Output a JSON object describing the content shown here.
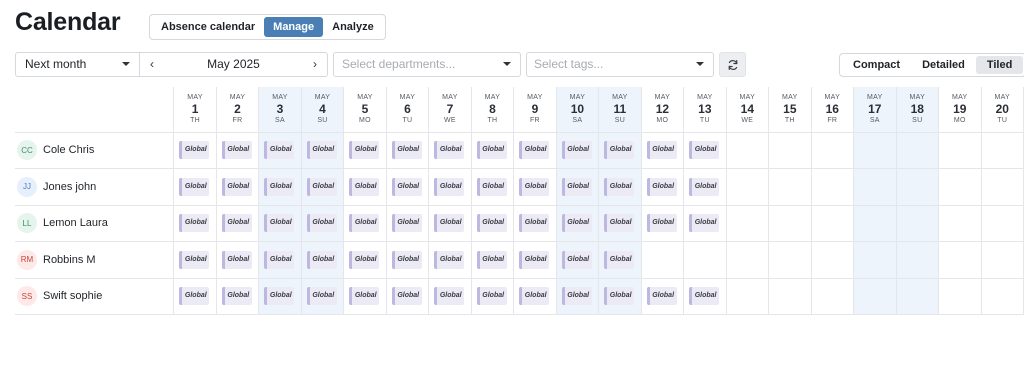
{
  "header": {
    "title": "Calendar"
  },
  "view_tabs": [
    {
      "label": "Absence calendar",
      "active": false
    },
    {
      "label": "Manage",
      "active": true
    },
    {
      "label": "Analyze",
      "active": false
    }
  ],
  "filters": {
    "period": "Next month",
    "month": "May 2025",
    "prev_icon": "chevron-left-icon",
    "next_icon": "chevron-right-icon",
    "departments_placeholder": "Select departments...",
    "tags_placeholder": "Select tags...",
    "refresh_icon": "refresh-icon"
  },
  "density_tabs": [
    {
      "label": "Compact",
      "active": false
    },
    {
      "label": "Detailed",
      "active": false
    },
    {
      "label": "Tiled",
      "active": true
    }
  ],
  "days": [
    {
      "mon": "MAY",
      "num": "1",
      "dow": "TH",
      "weekend": false
    },
    {
      "mon": "MAY",
      "num": "2",
      "dow": "FR",
      "weekend": false
    },
    {
      "mon": "MAY",
      "num": "3",
      "dow": "SA",
      "weekend": true
    },
    {
      "mon": "MAY",
      "num": "4",
      "dow": "SU",
      "weekend": true
    },
    {
      "mon": "MAY",
      "num": "5",
      "dow": "MO",
      "weekend": false
    },
    {
      "mon": "MAY",
      "num": "6",
      "dow": "TU",
      "weekend": false
    },
    {
      "mon": "MAY",
      "num": "7",
      "dow": "WE",
      "weekend": false
    },
    {
      "mon": "MAY",
      "num": "8",
      "dow": "TH",
      "weekend": false
    },
    {
      "mon": "MAY",
      "num": "9",
      "dow": "FR",
      "weekend": false
    },
    {
      "mon": "MAY",
      "num": "10",
      "dow": "SA",
      "weekend": true
    },
    {
      "mon": "MAY",
      "num": "11",
      "dow": "SU",
      "weekend": true
    },
    {
      "mon": "MAY",
      "num": "12",
      "dow": "MO",
      "weekend": false
    },
    {
      "mon": "MAY",
      "num": "13",
      "dow": "TU",
      "weekend": false
    },
    {
      "mon": "MAY",
      "num": "14",
      "dow": "WE",
      "weekend": false
    },
    {
      "mon": "MAY",
      "num": "15",
      "dow": "TH",
      "weekend": false
    },
    {
      "mon": "MAY",
      "num": "16",
      "dow": "FR",
      "weekend": false
    },
    {
      "mon": "MAY",
      "num": "17",
      "dow": "SA",
      "weekend": true
    },
    {
      "mon": "MAY",
      "num": "18",
      "dow": "SU",
      "weekend": true
    },
    {
      "mon": "MAY",
      "num": "19",
      "dow": "MO",
      "weekend": false
    },
    {
      "mon": "MAY",
      "num": "20",
      "dow": "TU",
      "weekend": false
    }
  ],
  "entry_label": "Global",
  "colors": {
    "accent": "#4a7fb5",
    "weekend": "#eef4fc",
    "chip_bg": "#ecebf5",
    "chip_bar": "#bdb8e0"
  },
  "employees": [
    {
      "initials": "CC",
      "name": "Cole Chris",
      "avatar_bg": "#e6f4ee",
      "avatar_fg": "#3f8f6a",
      "entries": 13
    },
    {
      "initials": "JJ",
      "name": "Jones john",
      "avatar_bg": "#e6effb",
      "avatar_fg": "#4d7fc0",
      "entries": 13
    },
    {
      "initials": "LL",
      "name": "Lemon Laura",
      "avatar_bg": "#e6f4ee",
      "avatar_fg": "#3f8f6a",
      "entries": 13
    },
    {
      "initials": "RM",
      "name": "Robbins M",
      "avatar_bg": "#fde9e8",
      "avatar_fg": "#c8453d",
      "entries": 11
    },
    {
      "initials": "SS",
      "name": "Swift sophie",
      "avatar_bg": "#fde9e8",
      "avatar_fg": "#c8453d",
      "entries": 13
    }
  ]
}
